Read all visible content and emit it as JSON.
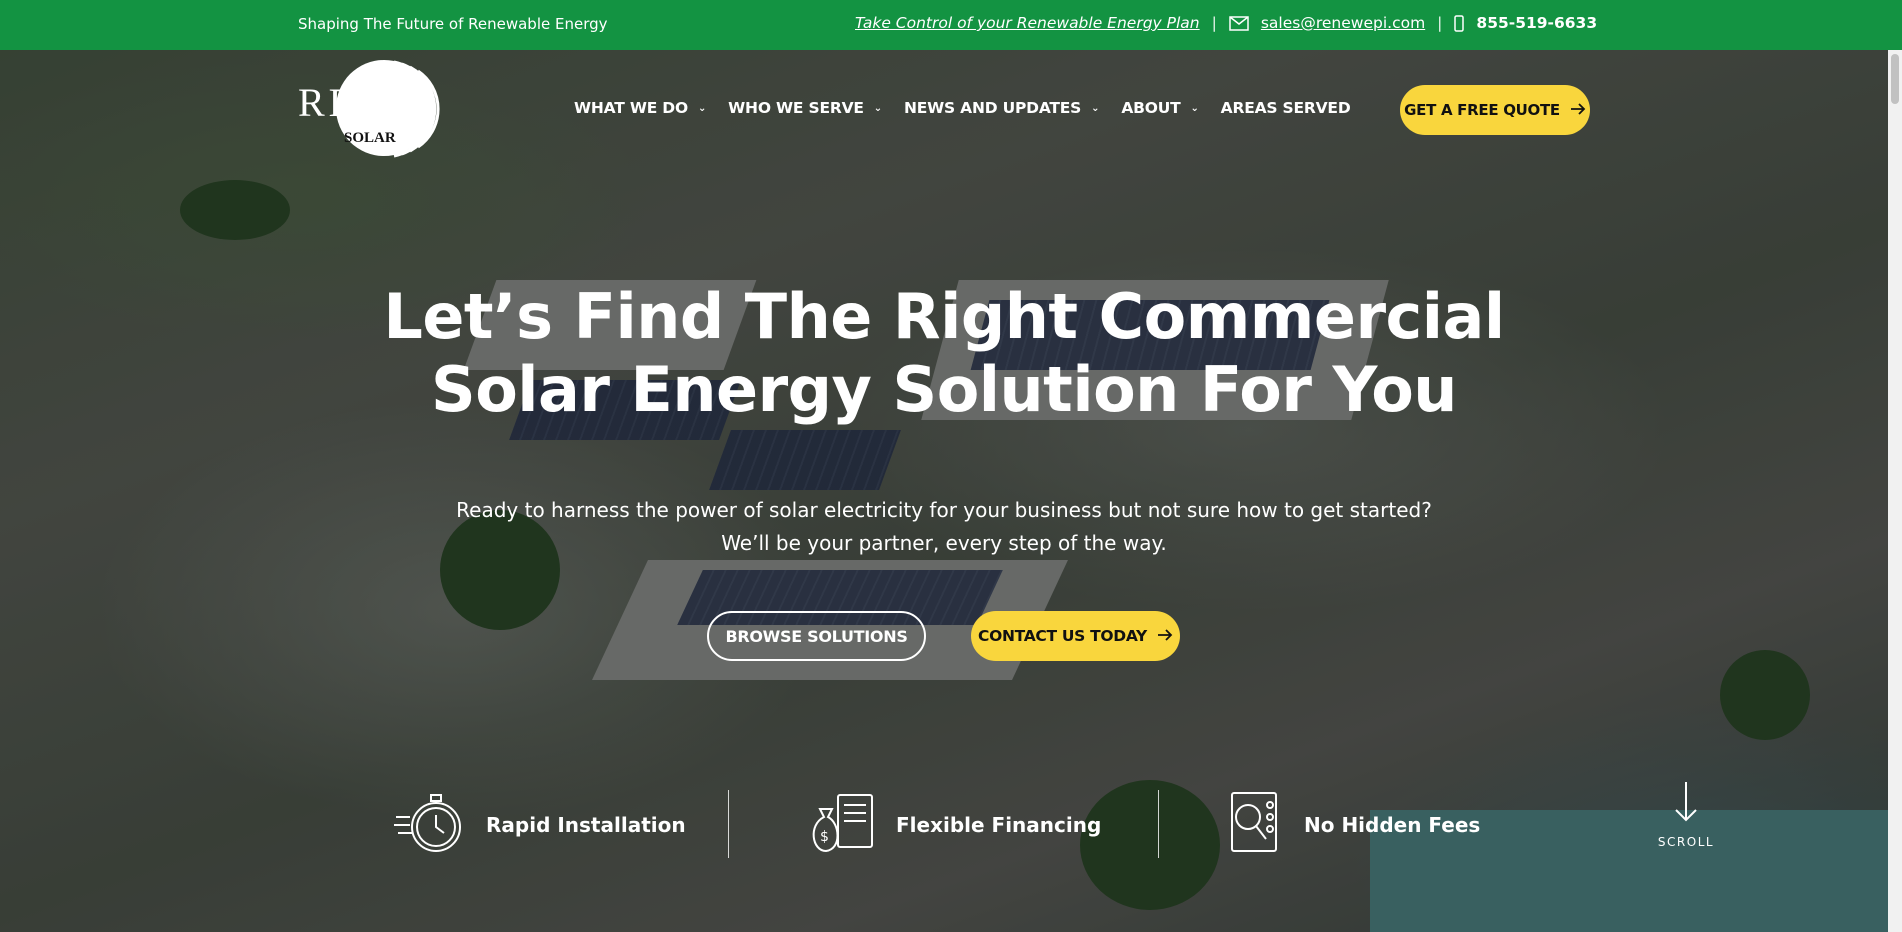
{
  "topbar": {
    "tagline": "Shaping The Future of Renewable Energy",
    "plan_link": "Take Control of your Renewable Energy Plan",
    "separator": "|",
    "email": "sales@renewepi.com",
    "phone": "855-519-6633",
    "background_color": "#139342"
  },
  "logo": {
    "main": "REP",
    "sub": "SOLAR"
  },
  "nav": {
    "items": [
      {
        "label": "WHAT WE DO",
        "dropdown": true
      },
      {
        "label": "WHO WE SERVE",
        "dropdown": true
      },
      {
        "label": "NEWS AND UPDATES",
        "dropdown": true
      },
      {
        "label": "ABOUT",
        "dropdown": true
      },
      {
        "label": "AREAS SERVED",
        "dropdown": false
      }
    ],
    "cta": "GET A FREE QUOTE"
  },
  "hero": {
    "headline_line1": "Let’s Find The Right Commercial",
    "headline_line2": "Solar Energy Solution For You",
    "sub_line1": "Ready to harness the power of solar electricity for your business but not sure how to get started?",
    "sub_line2": "We’ll be your partner, every step of the way.",
    "browse_button": "BROWSE SOLUTIONS",
    "contact_button": "CONTACT US TODAY",
    "accent_color": "#f9d63d"
  },
  "features": [
    {
      "label": "Rapid Installation",
      "icon": "stopwatch-icon"
    },
    {
      "label": "Flexible Financing",
      "icon": "money-bag-icon"
    },
    {
      "label": "No Hidden Fees",
      "icon": "magnifier-document-icon"
    }
  ],
  "scroll": {
    "label": "SCROLL"
  }
}
